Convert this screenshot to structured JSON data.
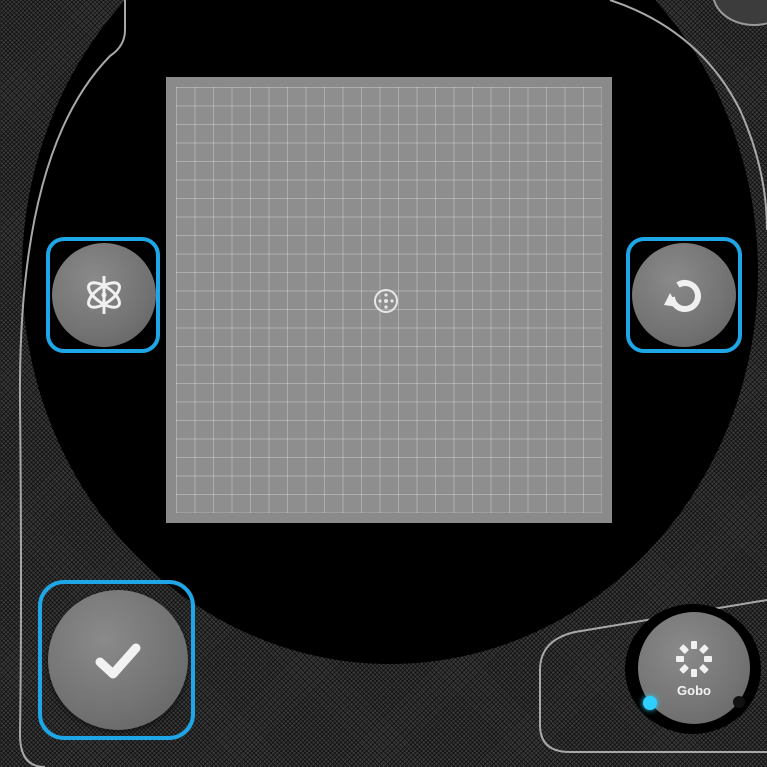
{
  "controls": {
    "left_button": {
      "icon": "gyro-icon"
    },
    "right_button": {
      "icon": "rotate-icon"
    },
    "confirm_button": {
      "icon": "checkmark-icon"
    },
    "gobo_button": {
      "label": "Gobo",
      "icon": "gobo-icon"
    }
  },
  "grid": {
    "center_icon": "crosshair-icon"
  },
  "colors": {
    "highlight": "#1ea6e6",
    "indicator": "#2fd0ff",
    "button": "#7a7a7a",
    "grid": "#8e8e8e",
    "background": "#000000"
  }
}
